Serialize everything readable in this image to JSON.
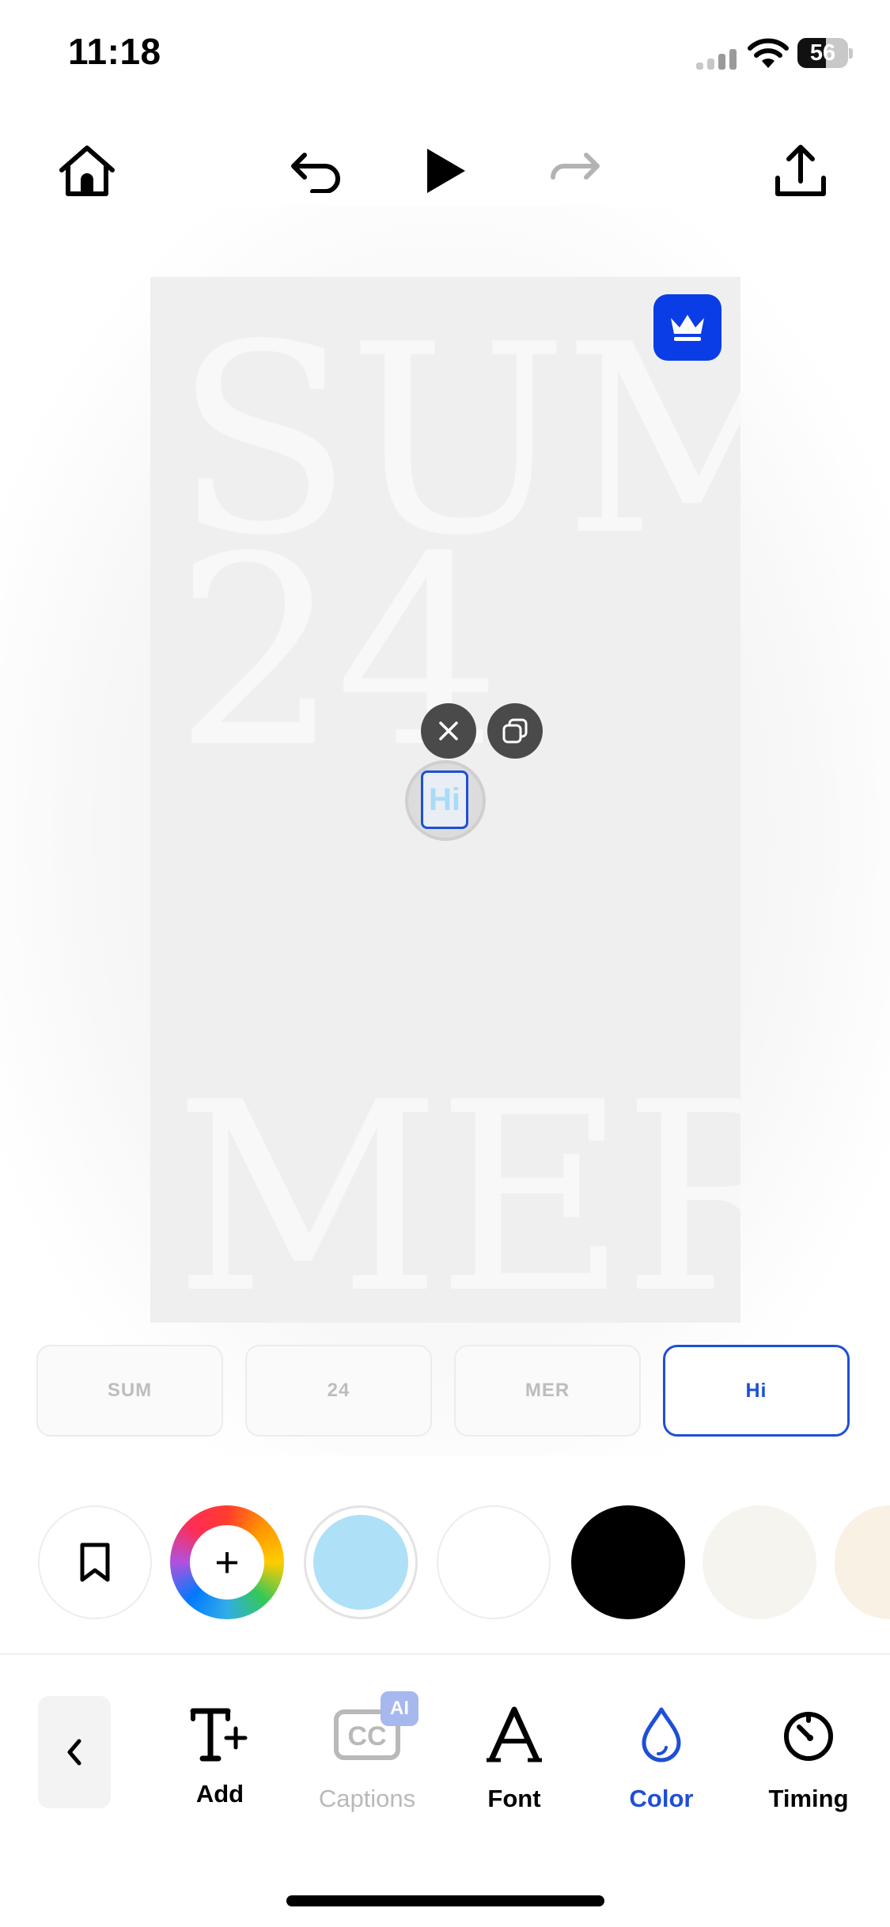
{
  "status_bar": {
    "time": "11:18",
    "battery": "56"
  },
  "canvas": {
    "words": [
      "SUM",
      "24",
      "MER"
    ],
    "text_layer_glyph": "Hi"
  },
  "layers": [
    {
      "label": "SUM",
      "selected": false
    },
    {
      "label": "24",
      "selected": false
    },
    {
      "label": "MER",
      "selected": false
    },
    {
      "label": "Hi",
      "selected": true
    }
  ],
  "colors": {
    "add_symbol": "+",
    "swatches": [
      "#aee0f8",
      "#ffffff",
      "#000000",
      "#f6f4ef",
      "#f8f1e4"
    ],
    "selected": "#aee0f8"
  },
  "toolbar": {
    "add_label": "Add",
    "captions_label": "Captions",
    "captions_badge": "AI",
    "font_label": "Font",
    "color_label": "Color",
    "timing_label": "Timing",
    "active": "Color",
    "accent": "#1e4fd6"
  }
}
